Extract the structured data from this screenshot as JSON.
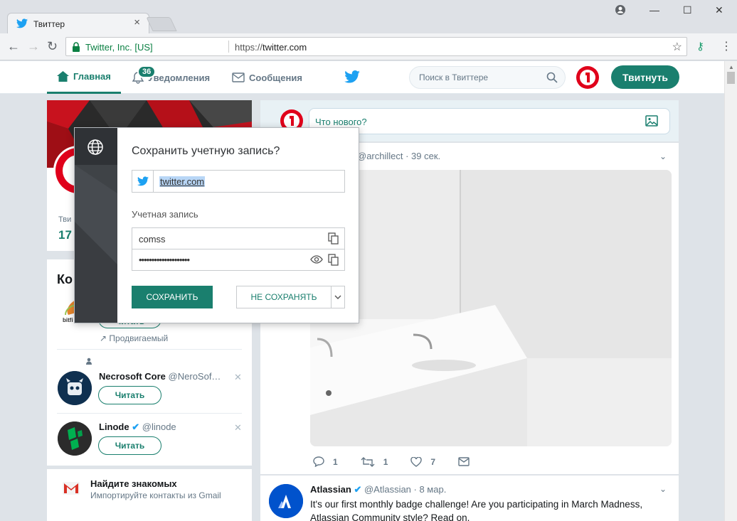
{
  "browser": {
    "tab_title": "Твиттер",
    "site_identity": "Twitter, Inc. [US]",
    "url_scheme": "https://",
    "url_host": "twitter.com"
  },
  "header": {
    "nav": [
      {
        "label": "Главная",
        "icon": "home-icon"
      },
      {
        "label": "Уведомления",
        "icon": "bell-icon",
        "badge": "36"
      },
      {
        "label": "Сообщения",
        "icon": "envelope-icon"
      }
    ],
    "search_placeholder": "Поиск в Твиттере",
    "tweet_button": "Твитнуть"
  },
  "profile": {
    "stat_label": "Тви",
    "stat_value": "17"
  },
  "who_to_follow": {
    "title": "Ко",
    "promoted_logo": "bitfi",
    "promoted_label": "Продвигаемый",
    "follow_label": "Читать",
    "accounts": [
      {
        "name": "Necrosoft Core",
        "handle": "@NeroSof…"
      },
      {
        "name": "Linode",
        "handle": "@linode"
      }
    ]
  },
  "find_friends": {
    "title": "Найдите знакомых",
    "subtitle": "Импортируйте контакты из Gmail"
  },
  "compose": {
    "placeholder": "Что нового?"
  },
  "tweet1": {
    "meta": "@archillect · 39 сек.",
    "replies": "1",
    "retweets": "1",
    "likes": "7"
  },
  "tweet2": {
    "name": "Atlassian",
    "handle": "@Atlassian · 8 мар.",
    "text": "It's our first monthly badge challenge! Are you participating in March Madness, Atlassian Community style? Read on."
  },
  "password_manager": {
    "title": "Сохранить учетную запись?",
    "site": "twitter.com",
    "account_label": "Учетная запись",
    "username": "comss",
    "password_masked": "••••••••••••••••••••",
    "save_label": "СОХРАНИТЬ",
    "dont_save_label": "НЕ СОХРАНЯТЬ"
  },
  "colors": {
    "accent": "#1a7f6e",
    "twitter_blue": "#1da1f2",
    "background": "#dee3e8"
  }
}
